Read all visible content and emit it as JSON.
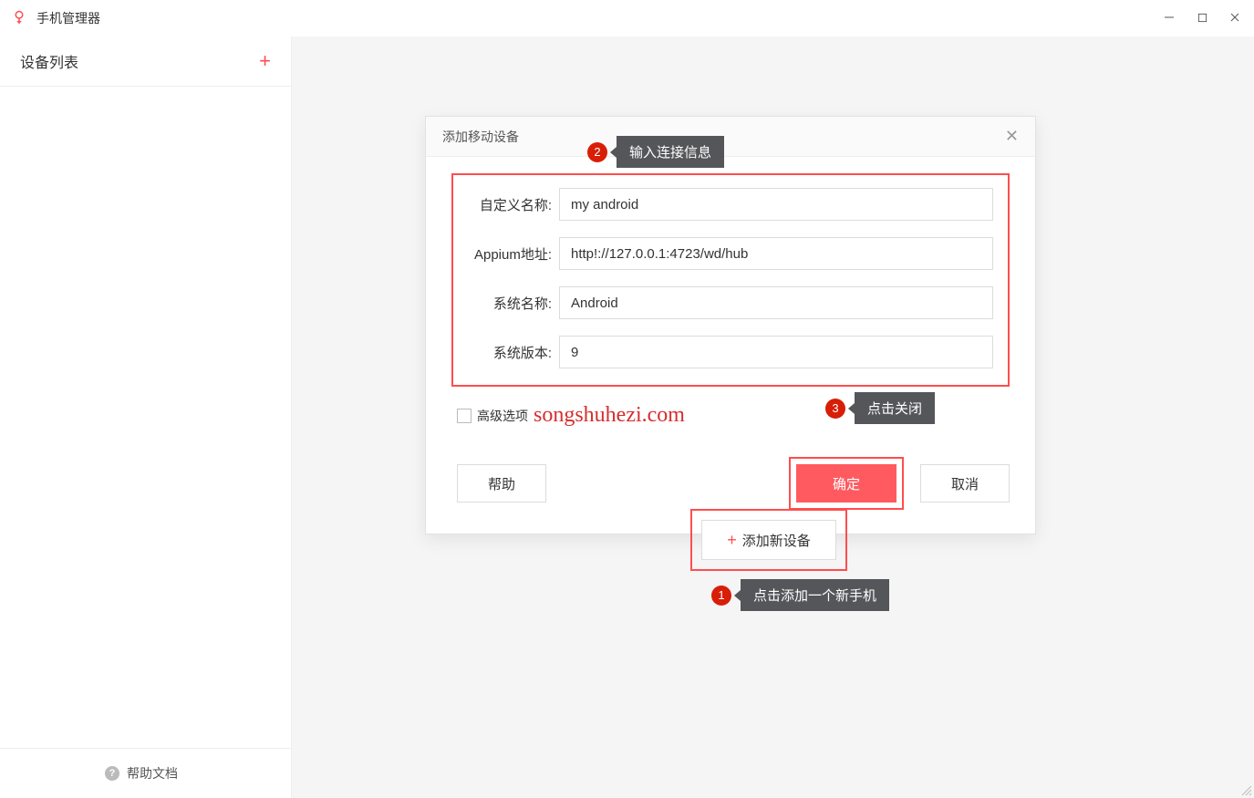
{
  "titlebar": {
    "app_name": "手机管理器"
  },
  "sidebar": {
    "title": "设备列表",
    "help_docs": "帮助文档"
  },
  "dialog": {
    "title": "添加移动设备",
    "fields": {
      "custom_name_label": "自定义名称:",
      "custom_name_value": "my android",
      "appium_label": "Appium地址:",
      "appium_value": "http!://127.0.0.1:4723/wd/hub",
      "sys_name_label": "系统名称:",
      "sys_name_value": "Android",
      "sys_ver_label": "系统版本:",
      "sys_ver_value": "9"
    },
    "advanced_label": "高级选项",
    "watermark": "songshuhezi.com",
    "buttons": {
      "help": "帮助",
      "confirm": "确定",
      "cancel": "取消"
    }
  },
  "add_new_device_label": "添加新设备",
  "annotations": {
    "step1": "点击添加一个新手机",
    "step2": "输入连接信息",
    "step3": "点击关闭"
  }
}
